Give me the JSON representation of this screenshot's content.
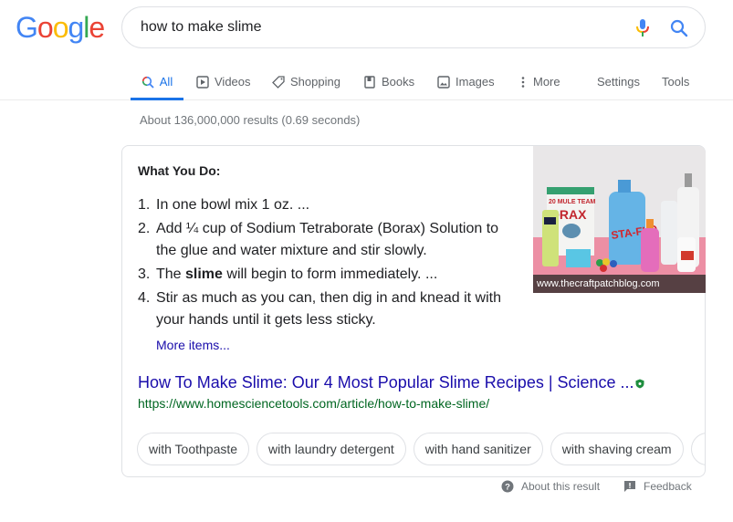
{
  "logo": {
    "text": "Google",
    "letters": [
      {
        "ch": "G",
        "color": "#4285f4"
      },
      {
        "ch": "o",
        "color": "#ea4335"
      },
      {
        "ch": "o",
        "color": "#fbbc05"
      },
      {
        "ch": "g",
        "color": "#4285f4"
      },
      {
        "ch": "l",
        "color": "#34a853"
      },
      {
        "ch": "e",
        "color": "#ea4335"
      }
    ]
  },
  "search": {
    "query": "how to make slime",
    "mic_icon": "microphone-icon",
    "search_icon": "search-icon"
  },
  "tabs": [
    {
      "label": "All",
      "icon": "search-icon",
      "active": true
    },
    {
      "label": "Videos",
      "icon": "play-icon"
    },
    {
      "label": "Shopping",
      "icon": "tag-icon"
    },
    {
      "label": "Books",
      "icon": "book-icon"
    },
    {
      "label": "Images",
      "icon": "image-icon"
    },
    {
      "label": "More",
      "icon": "more-vert-icon"
    },
    {
      "label": "Settings"
    },
    {
      "label": "Tools"
    }
  ],
  "stats": "About 136,000,000 results (0.69 seconds)",
  "snippet": {
    "heading": "What You Do:",
    "steps": [
      {
        "num": "1.",
        "pre": "In one bowl mix 1 oz. ...",
        "bold": "",
        "post": ""
      },
      {
        "num": "2.",
        "pre": "Add ¼ cup of Sodium Tetraborate (Borax) Solution to the glue and water mixture and stir slowly.",
        "bold": "",
        "post": ""
      },
      {
        "num": "3.",
        "pre": "The ",
        "bold": "slime",
        "post": " will begin to form immediately. ..."
      },
      {
        "num": "4.",
        "pre": "Stir as much as you can, then dig in and knead it with your hands until it gets less sticky.",
        "bold": "",
        "post": ""
      }
    ],
    "more_items": "More items...",
    "title": "How To Make Slime: Our 4 Most Popular Slime Recipes | Science ...",
    "url": "https://www.homesciencetools.com/article/how-to-make-slime/",
    "image_caption": "www.thecraftpatchblog.com"
  },
  "chips": [
    "with Toothpaste",
    "with laundry detergent",
    "with hand sanitizer",
    "with shaving cream"
  ],
  "footer": {
    "about": "About this result",
    "feedback": "Feedback"
  }
}
